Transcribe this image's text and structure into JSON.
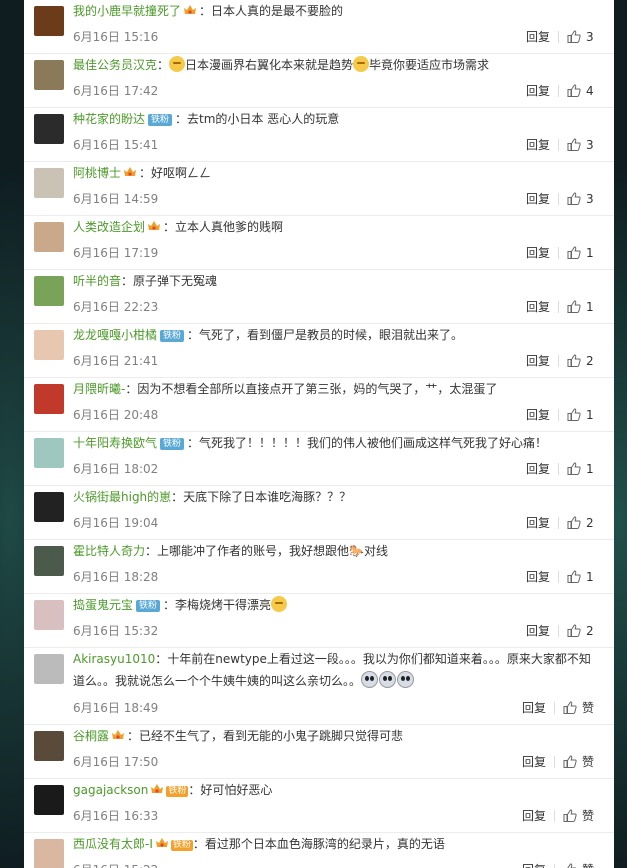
{
  "comments": [
    {
      "user": "我的小鹿早就撞死了",
      "badge": "crown",
      "fan": "",
      "text": "：日本人真的是最不要脸的",
      "time": "6月16日 15:16",
      "reply": "回复",
      "likes": "3",
      "avatar": "#6b3b1a"
    },
    {
      "user": "最佳公务员汉克",
      "badge": "",
      "fan": "",
      "text_pre": "：",
      "emoji1": true,
      "text": "日本漫画界右翼化本来就是趋势",
      "emoji2": true,
      "text2": "毕竟你要适应市场需求",
      "time": "6月16日 17:42",
      "reply": "回复",
      "likes": "4",
      "avatar": "#8a7a5a"
    },
    {
      "user": "种花家的盼达",
      "badge": "",
      "fan": "铁粉",
      "text": "：去tm的小日本  恶心人的玩意",
      "time": "6月16日 15:41",
      "reply": "回复",
      "likes": "3",
      "avatar": "#2b2b2b"
    },
    {
      "user": "阿桃博士",
      "badge": "crown",
      "fan": "",
      "text": "：好呕啊ㄥㄥ",
      "time": "6月16日 14:59",
      "reply": "回复",
      "likes": "3",
      "avatar": "#c9c2b5"
    },
    {
      "user": "人类改造企划",
      "badge": "crown",
      "fan": "",
      "text": "：立本人真他爹的贱啊",
      "time": "6月16日 17:19",
      "reply": "回复",
      "likes": "1",
      "avatar": "#c9a98a"
    },
    {
      "user": "听半的音",
      "badge": "",
      "fan": "",
      "text": "：原子弹下无冤魂",
      "time": "6月16日 22:23",
      "reply": "回复",
      "likes": "1",
      "avatar": "#7aa35a"
    },
    {
      "user": "龙龙嘎嘎小柑橘",
      "badge": "",
      "fan": "铁粉",
      "text": "：气死了，看到僵尸是教员的时候，眼泪就出来了。",
      "time": "6月16日 21:41",
      "reply": "回复",
      "likes": "2",
      "avatar": "#e8c7b0"
    },
    {
      "user": "月隈昕曦-",
      "badge": "",
      "fan": "",
      "text": "：因为不想看全部所以直接点开了第三张，妈的气哭了，艹，太混蛋了",
      "time": "6月16日 20:48",
      "reply": "回复",
      "likes": "1",
      "avatar": "#c0392b"
    },
    {
      "user": "十年阳寿换欧气",
      "badge": "",
      "fan": "铁粉",
      "text": "：气死我了！！！！！我们的伟人被他们画成这样气死我了好心痛！",
      "time": "6月16日 18:02",
      "reply": "回复",
      "likes": "1",
      "avatar": "#9ec7c0"
    },
    {
      "user": "火锅街最high的崽",
      "badge": "",
      "fan": "",
      "text": "：天底下除了日本谁吃海豚？？？",
      "time": "6月16日 19:04",
      "reply": "回复",
      "likes": "2",
      "avatar": "#222222"
    },
    {
      "user": "霍比特人奇力",
      "badge": "",
      "fan": "",
      "text": "：上哪能冲了作者的账号，我好想跟他🐎对线",
      "time": "6月16日 18:28",
      "reply": "回复",
      "likes": "1",
      "avatar": "#4b5a4a"
    },
    {
      "user": "捣蛋鬼元宝",
      "badge": "",
      "fan": "铁粉",
      "text": "：李梅烧烤干得漂亮",
      "emoji2": true,
      "time": "6月16日 15:32",
      "reply": "回复",
      "likes": "2",
      "avatar": "#d8c0c0"
    }
  ],
  "tall": {
    "user": "Akirasyu1010",
    "text": "：十年前在newtype上看过这一段。。。我以为你们都知道来着。。。原来大家都不知道么。。我就说怎么一个个牛姨牛姨的叫这么亲切么。。",
    "time": "6月16日 18:49",
    "reply": "回复",
    "likes": "赞",
    "avatar": "#bbbbbb"
  },
  "tail": [
    {
      "user": "谷桐露",
      "badge": "crown",
      "fan": "",
      "text": "：已经不生气了，看到无能的小鬼子跳脚只觉得可悲",
      "time": "6月16日 17:50",
      "reply": "回复",
      "likes": "赞",
      "avatar": "#5a4a3a"
    },
    {
      "user": "gagajackson",
      "badge": "crown",
      "iron": "铁粉",
      "text": "：好可怕好恶心",
      "time": "6月16日 16:33",
      "reply": "回复",
      "likes": "赞",
      "avatar": "#1a1a1a"
    },
    {
      "user": "西瓜没有太郎-I",
      "badge": "crown",
      "iron": "铁粉",
      "text": "：看过那个日本血色海豚湾的纪录片，真的无语",
      "time": "6月16日 15:22",
      "reply": "回复",
      "likes": "赞",
      "avatar": "#d9b7a0"
    }
  ]
}
